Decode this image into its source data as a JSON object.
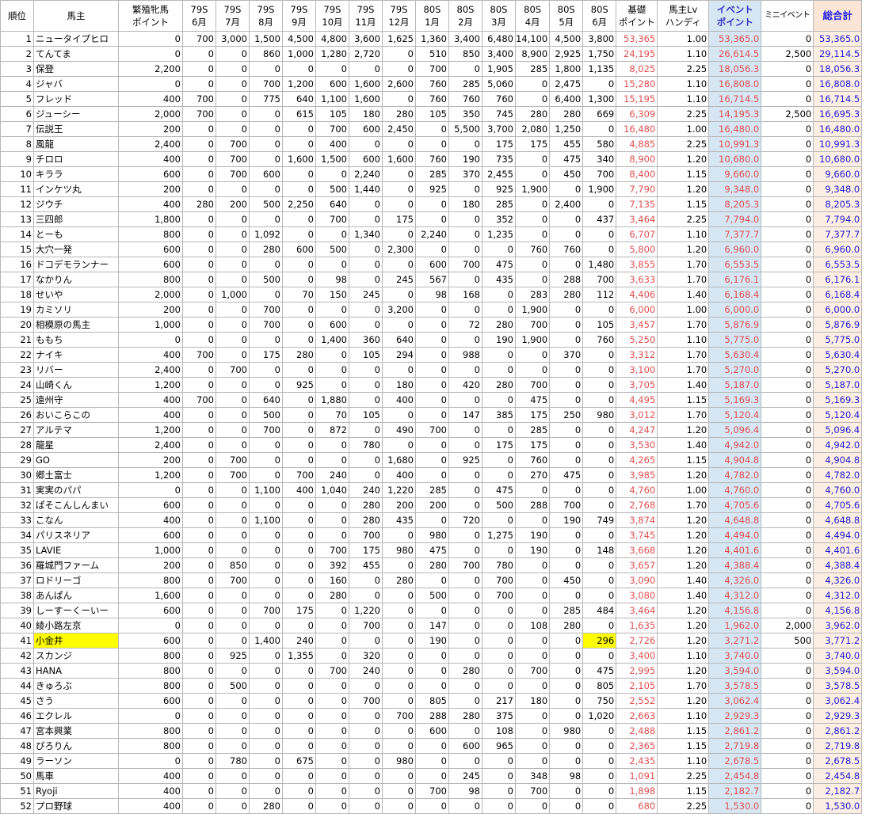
{
  "table": {
    "headers": [
      {
        "key": "rank",
        "l1": "順位",
        "l2": ""
      },
      {
        "key": "owner",
        "l1": "馬主",
        "l2": ""
      },
      {
        "key": "breeding",
        "l1": "繁殖牝馬",
        "l2": "ポイント"
      },
      {
        "key": "m79_6",
        "l1": "79S",
        "l2": "6月"
      },
      {
        "key": "m79_7",
        "l1": "79S",
        "l2": "7月"
      },
      {
        "key": "m79_8",
        "l1": "79S",
        "l2": "8月"
      },
      {
        "key": "m79_9",
        "l1": "79S",
        "l2": "9月"
      },
      {
        "key": "m79_10",
        "l1": "79S",
        "l2": "10月"
      },
      {
        "key": "m79_11",
        "l1": "79S",
        "l2": "11月"
      },
      {
        "key": "m79_12",
        "l1": "79S",
        "l2": "12月"
      },
      {
        "key": "m80_1",
        "l1": "80S",
        "l2": "1月"
      },
      {
        "key": "m80_2",
        "l1": "80S",
        "l2": "2月"
      },
      {
        "key": "m80_3",
        "l1": "80S",
        "l2": "3月"
      },
      {
        "key": "m80_4",
        "l1": "80S",
        "l2": "4月"
      },
      {
        "key": "m80_5",
        "l1": "80S",
        "l2": "5月"
      },
      {
        "key": "m80_6",
        "l1": "80S",
        "l2": "6月"
      },
      {
        "key": "base",
        "l1": "基礎",
        "l2": "ポイント"
      },
      {
        "key": "lv",
        "l1": "馬主Lv",
        "l2": "ハンディ"
      },
      {
        "key": "event",
        "l1": "イベント",
        "l2": "ポイント"
      },
      {
        "key": "mini",
        "l1": "ミニイベント",
        "l2": ""
      },
      {
        "key": "total",
        "l1": "総合計",
        "l2": ""
      }
    ],
    "rows": [
      [
        "1",
        "ニュータイプヒロ",
        "0",
        "700",
        "3,000",
        "1,500",
        "4,500",
        "4,800",
        "3,600",
        "1,625",
        "1,360",
        "3,400",
        "6,480",
        "14,100",
        "4,500",
        "3,800",
        "53,365",
        "1.00",
        "53,365.0",
        "0",
        "53,365.0"
      ],
      [
        "2",
        "てんてま",
        "0",
        "0",
        "0",
        "860",
        "1,000",
        "1,280",
        "2,720",
        "0",
        "510",
        "850",
        "3,400",
        "8,900",
        "2,925",
        "1,750",
        "24,195",
        "1.10",
        "26,614.5",
        "2,500",
        "29,114.5"
      ],
      [
        "3",
        "保登",
        "2,200",
        "0",
        "0",
        "0",
        "0",
        "0",
        "0",
        "0",
        "700",
        "0",
        "1,905",
        "285",
        "1,800",
        "1,135",
        "8,025",
        "2.25",
        "18,056.3",
        "0",
        "18,056.3"
      ],
      [
        "4",
        "ジャバ",
        "0",
        "0",
        "0",
        "700",
        "1,200",
        "600",
        "1,600",
        "2,600",
        "760",
        "285",
        "5,060",
        "0",
        "2,475",
        "0",
        "15,280",
        "1.10",
        "16,808.0",
        "0",
        "16,808.0"
      ],
      [
        "5",
        "フレッド",
        "400",
        "700",
        "0",
        "775",
        "640",
        "1,100",
        "1,600",
        "0",
        "760",
        "760",
        "760",
        "0",
        "6,400",
        "1,300",
        "15,195",
        "1.10",
        "16,714.5",
        "0",
        "16,714.5"
      ],
      [
        "6",
        "ジューシー",
        "2,000",
        "700",
        "0",
        "0",
        "615",
        "105",
        "180",
        "280",
        "105",
        "350",
        "745",
        "280",
        "280",
        "669",
        "6,309",
        "2.25",
        "14,195.3",
        "2,500",
        "16,695.3"
      ],
      [
        "7",
        "伝説王",
        "200",
        "0",
        "0",
        "0",
        "0",
        "700",
        "600",
        "2,450",
        "0",
        "5,500",
        "3,700",
        "2,080",
        "1,250",
        "0",
        "16,480",
        "1.00",
        "16,480.0",
        "0",
        "16,480.0"
      ],
      [
        "8",
        "風龍",
        "2,400",
        "0",
        "700",
        "0",
        "0",
        "400",
        "0",
        "0",
        "0",
        "0",
        "175",
        "175",
        "455",
        "580",
        "4,885",
        "2.25",
        "10,991.3",
        "0",
        "10,991.3"
      ],
      [
        "9",
        "チロロ",
        "400",
        "0",
        "700",
        "0",
        "1,600",
        "1,500",
        "600",
        "1,600",
        "760",
        "190",
        "735",
        "0",
        "475",
        "340",
        "8,900",
        "1.20",
        "10,680.0",
        "0",
        "10,680.0"
      ],
      [
        "10",
        "キララ",
        "600",
        "0",
        "700",
        "600",
        "0",
        "0",
        "2,240",
        "0",
        "285",
        "370",
        "2,455",
        "0",
        "450",
        "700",
        "8,400",
        "1.15",
        "9,660.0",
        "0",
        "9,660.0"
      ],
      [
        "11",
        "インケツ丸",
        "200",
        "0",
        "0",
        "0",
        "0",
        "500",
        "1,440",
        "0",
        "925",
        "0",
        "925",
        "1,900",
        "0",
        "1,900",
        "7,790",
        "1.20",
        "9,348.0",
        "0",
        "9,348.0"
      ],
      [
        "12",
        "ジウチ",
        "400",
        "280",
        "200",
        "500",
        "2,250",
        "640",
        "0",
        "0",
        "0",
        "180",
        "285",
        "0",
        "2,400",
        "0",
        "7,135",
        "1.15",
        "8,205.3",
        "0",
        "8,205.3"
      ],
      [
        "13",
        "三四郎",
        "1,800",
        "0",
        "0",
        "0",
        "0",
        "700",
        "0",
        "175",
        "0",
        "0",
        "352",
        "0",
        "0",
        "437",
        "3,464",
        "2.25",
        "7,794.0",
        "0",
        "7,794.0"
      ],
      [
        "14",
        "とーも",
        "800",
        "0",
        "0",
        "1,092",
        "0",
        "0",
        "1,340",
        "0",
        "2,240",
        "0",
        "1,235",
        "0",
        "0",
        "0",
        "6,707",
        "1.10",
        "7,377.7",
        "0",
        "7,377.7"
      ],
      [
        "15",
        "大穴一発",
        "600",
        "0",
        "0",
        "280",
        "600",
        "500",
        "0",
        "2,300",
        "0",
        "0",
        "0",
        "760",
        "760",
        "0",
        "5,800",
        "1.20",
        "6,960.0",
        "0",
        "6,960.0"
      ],
      [
        "16",
        "ドコデモランナー",
        "600",
        "0",
        "0",
        "0",
        "0",
        "0",
        "0",
        "0",
        "600",
        "700",
        "475",
        "0",
        "0",
        "1,480",
        "3,855",
        "1.70",
        "6,553.5",
        "0",
        "6,553.5"
      ],
      [
        "17",
        "なかりん",
        "800",
        "0",
        "0",
        "500",
        "0",
        "98",
        "0",
        "245",
        "567",
        "0",
        "435",
        "0",
        "288",
        "700",
        "3,633",
        "1.70",
        "6,176.1",
        "0",
        "6,176.1"
      ],
      [
        "18",
        "せいや",
        "2,000",
        "0",
        "1,000",
        "0",
        "70",
        "150",
        "245",
        "0",
        "98",
        "168",
        "0",
        "283",
        "280",
        "112",
        "4,406",
        "1.40",
        "6,168.4",
        "0",
        "6,168.4"
      ],
      [
        "19",
        "カミソリ",
        "200",
        "0",
        "0",
        "700",
        "0",
        "0",
        "0",
        "3,200",
        "0",
        "0",
        "0",
        "1,900",
        "0",
        "0",
        "6,000",
        "1.00",
        "6,000.0",
        "0",
        "6,000.0"
      ],
      [
        "20",
        "相模原の馬主",
        "1,000",
        "0",
        "0",
        "700",
        "0",
        "600",
        "0",
        "0",
        "0",
        "72",
        "280",
        "700",
        "0",
        "105",
        "3,457",
        "1.70",
        "5,876.9",
        "0",
        "5,876.9"
      ],
      [
        "21",
        "ももち",
        "0",
        "0",
        "0",
        "0",
        "0",
        "1,400",
        "360",
        "640",
        "0",
        "0",
        "190",
        "1,900",
        "0",
        "760",
        "5,250",
        "1.10",
        "5,775.0",
        "0",
        "5,775.0"
      ],
      [
        "22",
        "ナイキ",
        "400",
        "700",
        "0",
        "175",
        "280",
        "0",
        "105",
        "294",
        "0",
        "988",
        "0",
        "0",
        "370",
        "0",
        "3,312",
        "1.70",
        "5,630.4",
        "0",
        "5,630.4"
      ],
      [
        "23",
        "リバー",
        "2,400",
        "0",
        "700",
        "0",
        "0",
        "0",
        "0",
        "0",
        "0",
        "0",
        "0",
        "0",
        "0",
        "0",
        "3,100",
        "1.70",
        "5,270.0",
        "0",
        "5,270.0"
      ],
      [
        "24",
        "山崎くん",
        "1,200",
        "0",
        "0",
        "0",
        "925",
        "0",
        "0",
        "180",
        "0",
        "420",
        "280",
        "700",
        "0",
        "0",
        "3,705",
        "1.40",
        "5,187.0",
        "0",
        "5,187.0"
      ],
      [
        "25",
        "遠州守",
        "400",
        "700",
        "0",
        "640",
        "0",
        "1,880",
        "0",
        "400",
        "0",
        "0",
        "0",
        "475",
        "0",
        "0",
        "4,495",
        "1.15",
        "5,169.3",
        "0",
        "5,169.3"
      ],
      [
        "26",
        "おいこらこの",
        "400",
        "0",
        "0",
        "500",
        "0",
        "70",
        "105",
        "0",
        "0",
        "147",
        "385",
        "175",
        "250",
        "980",
        "3,012",
        "1.70",
        "5,120.4",
        "0",
        "5,120.4"
      ],
      [
        "27",
        "アルテマ",
        "1,200",
        "0",
        "0",
        "700",
        "0",
        "872",
        "0",
        "490",
        "700",
        "0",
        "0",
        "285",
        "0",
        "0",
        "4,247",
        "1.20",
        "5,096.4",
        "0",
        "5,096.4"
      ],
      [
        "28",
        "龍星",
        "2,400",
        "0",
        "0",
        "0",
        "0",
        "0",
        "780",
        "0",
        "0",
        "0",
        "175",
        "175",
        "0",
        "0",
        "3,530",
        "1.40",
        "4,942.0",
        "0",
        "4,942.0"
      ],
      [
        "29",
        "GO",
        "200",
        "0",
        "700",
        "0",
        "0",
        "0",
        "0",
        "1,680",
        "0",
        "925",
        "0",
        "760",
        "0",
        "0",
        "4,265",
        "1.15",
        "4,904.8",
        "0",
        "4,904.8"
      ],
      [
        "30",
        "郷土富士",
        "1,200",
        "0",
        "700",
        "0",
        "700",
        "240",
        "0",
        "400",
        "0",
        "0",
        "0",
        "270",
        "475",
        "0",
        "3,985",
        "1.20",
        "4,782.0",
        "0",
        "4,782.0"
      ],
      [
        "31",
        "実実のパパ",
        "0",
        "0",
        "0",
        "1,100",
        "400",
        "1,040",
        "240",
        "1,220",
        "285",
        "0",
        "475",
        "0",
        "0",
        "0",
        "4,760",
        "1.00",
        "4,760.0",
        "0",
        "4,760.0"
      ],
      [
        "32",
        "ぱそこんしんまい",
        "600",
        "0",
        "0",
        "0",
        "0",
        "0",
        "280",
        "200",
        "200",
        "0",
        "500",
        "288",
        "700",
        "0",
        "2,768",
        "1.70",
        "4,705.6",
        "0",
        "4,705.6"
      ],
      [
        "33",
        "こなん",
        "400",
        "0",
        "0",
        "1,100",
        "0",
        "0",
        "280",
        "435",
        "0",
        "720",
        "0",
        "0",
        "190",
        "749",
        "3,874",
        "1.20",
        "4,648.8",
        "0",
        "4,648.8"
      ],
      [
        "34",
        "パリスネリア",
        "600",
        "0",
        "0",
        "0",
        "0",
        "0",
        "700",
        "0",
        "980",
        "0",
        "1,275",
        "190",
        "0",
        "0",
        "3,745",
        "1.20",
        "4,494.0",
        "0",
        "4,494.0"
      ],
      [
        "35",
        "LAVIE",
        "1,000",
        "0",
        "0",
        "0",
        "0",
        "700",
        "175",
        "980",
        "475",
        "0",
        "0",
        "190",
        "0",
        "148",
        "3,668",
        "1.20",
        "4,401.6",
        "0",
        "4,401.6"
      ],
      [
        "36",
        "羅城門ファーム",
        "200",
        "0",
        "850",
        "0",
        "0",
        "392",
        "455",
        "0",
        "280",
        "700",
        "780",
        "0",
        "0",
        "0",
        "3,657",
        "1.20",
        "4,388.4",
        "0",
        "4,388.4"
      ],
      [
        "37",
        "ロドリーゴ",
        "800",
        "0",
        "700",
        "0",
        "0",
        "160",
        "0",
        "280",
        "0",
        "0",
        "700",
        "0",
        "450",
        "0",
        "3,090",
        "1.40",
        "4,326.0",
        "0",
        "4,326.0"
      ],
      [
        "38",
        "あんぱん",
        "1,600",
        "0",
        "0",
        "0",
        "0",
        "280",
        "0",
        "0",
        "500",
        "0",
        "700",
        "0",
        "0",
        "0",
        "3,080",
        "1.40",
        "4,312.0",
        "0",
        "4,312.0"
      ],
      [
        "39",
        "しーすーくーいー",
        "600",
        "0",
        "0",
        "700",
        "175",
        "0",
        "1,220",
        "0",
        "0",
        "0",
        "0",
        "0",
        "285",
        "484",
        "3,464",
        "1.20",
        "4,156.8",
        "0",
        "4,156.8"
      ],
      [
        "40",
        "綾小路左京",
        "0",
        "0",
        "0",
        "0",
        "0",
        "0",
        "700",
        "0",
        "147",
        "0",
        "0",
        "108",
        "280",
        "0",
        "1,635",
        "1.20",
        "1,962.0",
        "2,000",
        "3,962.0"
      ],
      [
        "41",
        "小金井",
        "600",
        "0",
        "0",
        "1,400",
        "240",
        "0",
        "0",
        "0",
        "190",
        "0",
        "0",
        "0",
        "0",
        "296",
        "2,726",
        "1.20",
        "3,271.2",
        "500",
        "3,771.2"
      ],
      [
        "42",
        "スカンジ",
        "800",
        "0",
        "925",
        "0",
        "1,355",
        "0",
        "320",
        "0",
        "0",
        "0",
        "0",
        "0",
        "0",
        "0",
        "3,400",
        "1.10",
        "3,740.0",
        "0",
        "3,740.0"
      ],
      [
        "43",
        "HANA",
        "800",
        "0",
        "0",
        "0",
        "0",
        "700",
        "240",
        "0",
        "0",
        "280",
        "0",
        "700",
        "0",
        "475",
        "2,995",
        "1.20",
        "3,594.0",
        "0",
        "3,594.0"
      ],
      [
        "44",
        "きゅろぶ",
        "800",
        "0",
        "500",
        "0",
        "0",
        "0",
        "0",
        "0",
        "0",
        "0",
        "0",
        "0",
        "0",
        "805",
        "2,105",
        "1.70",
        "3,578.5",
        "0",
        "3,578.5"
      ],
      [
        "45",
        "さう",
        "600",
        "0",
        "0",
        "0",
        "0",
        "0",
        "700",
        "0",
        "805",
        "0",
        "217",
        "180",
        "0",
        "750",
        "2,552",
        "1.20",
        "3,062.4",
        "0",
        "3,062.4"
      ],
      [
        "46",
        "エクレル",
        "0",
        "0",
        "0",
        "0",
        "0",
        "0",
        "0",
        "700",
        "288",
        "280",
        "375",
        "0",
        "0",
        "1,020",
        "2,663",
        "1.10",
        "2,929.3",
        "0",
        "2,929.3"
      ],
      [
        "47",
        "宮本興業",
        "800",
        "0",
        "0",
        "0",
        "0",
        "0",
        "0",
        "0",
        "600",
        "0",
        "108",
        "0",
        "980",
        "0",
        "2,488",
        "1.15",
        "2,861.2",
        "0",
        "2,861.2"
      ],
      [
        "48",
        "ぴろりん",
        "800",
        "0",
        "0",
        "0",
        "0",
        "0",
        "0",
        "0",
        "0",
        "600",
        "965",
        "0",
        "0",
        "0",
        "2,365",
        "1.15",
        "2,719.8",
        "0",
        "2,719.8"
      ],
      [
        "49",
        "ラーソン",
        "0",
        "0",
        "780",
        "0",
        "675",
        "0",
        "0",
        "980",
        "0",
        "0",
        "0",
        "0",
        "0",
        "0",
        "2,435",
        "1.10",
        "2,678.5",
        "0",
        "2,678.5"
      ],
      [
        "50",
        "馬車",
        "400",
        "0",
        "0",
        "0",
        "0",
        "0",
        "0",
        "0",
        "0",
        "245",
        "0",
        "348",
        "98",
        "0",
        "1,091",
        "2.25",
        "2,454.8",
        "0",
        "2,454.8"
      ],
      [
        "51",
        "Ryoji",
        "400",
        "0",
        "0",
        "0",
        "0",
        "0",
        "0",
        "0",
        "700",
        "98",
        "0",
        "700",
        "0",
        "0",
        "1,898",
        "1.15",
        "2,182.7",
        "0",
        "2,182.7"
      ],
      [
        "52",
        "プロ野球",
        "400",
        "0",
        "0",
        "280",
        "0",
        "0",
        "0",
        "0",
        "0",
        "0",
        "0",
        "0",
        "0",
        "0",
        "680",
        "2.25",
        "1,530.0",
        "0",
        "1,530.0"
      ]
    ],
    "highlight_row": "41",
    "highlight_columns": [
      "owner",
      "m80_6"
    ],
    "colors": {
      "base_text": "#e05050",
      "event_bg": "#d6e6f3",
      "event_header_text": "#3232c8",
      "total_bg": "#fdeee3",
      "total_text": "#2020d0",
      "highlight": "#ffff00",
      "grid": "#b7b7b7"
    }
  }
}
